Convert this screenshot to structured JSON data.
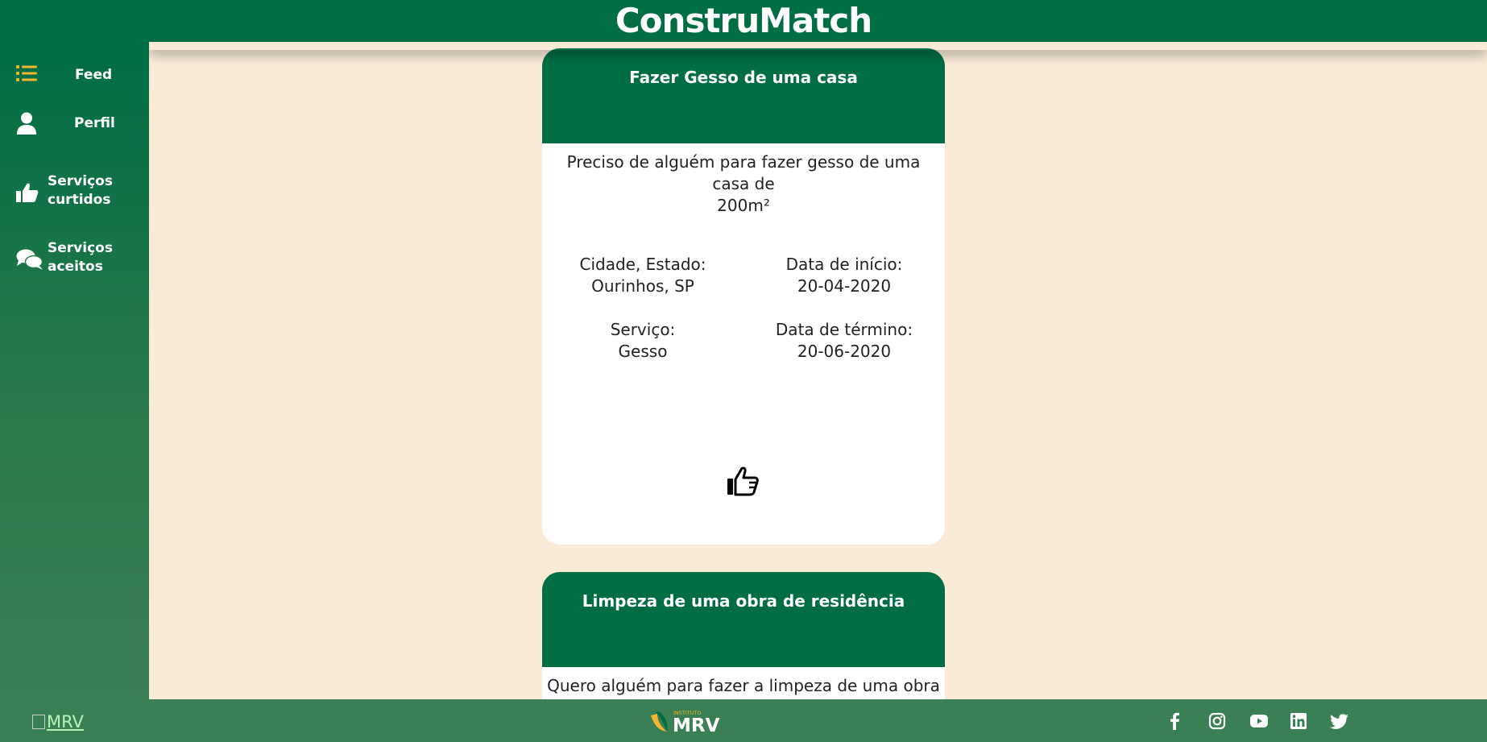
{
  "app": {
    "title": "ConstruMatch"
  },
  "sidebar": {
    "items": [
      {
        "label": "Feed",
        "icon": "list-icon",
        "active": true
      },
      {
        "label": "Perfil",
        "icon": "user-icon"
      },
      {
        "label_line1": "Serviços",
        "label_line2": "curtidos",
        "icon": "thumbs-up-icon"
      },
      {
        "label_line1": "Serviços",
        "label_line2": "aceitos",
        "icon": "chat-bubbles-icon"
      }
    ]
  },
  "cards": [
    {
      "title": "Fazer Gesso de uma casa",
      "description_line1": "Preciso de alguém para fazer gesso de uma casa de",
      "description_line2": "200m²",
      "city_label": "Cidade, Estado:",
      "city_value": "Ourinhos, SP",
      "start_label": "Data de início:",
      "start_value": "20-04-2020",
      "service_label": "Serviço:",
      "service_value": "Gesso",
      "end_label": "Data de término:",
      "end_value": "20-06-2020"
    },
    {
      "title": "Limpeza de uma obra de residência",
      "description_line1": "Quero alguém para fazer a limpeza de uma obra de"
    }
  ],
  "footer": {
    "broken_image_alt": "MRV",
    "logo_small_text": "INSTITUTO",
    "logo_text": "MRV",
    "social": [
      "facebook-icon",
      "instagram-icon",
      "youtube-icon",
      "linkedin-icon",
      "twitter-icon"
    ]
  },
  "colors": {
    "primary_green": "#006d43",
    "accent_yellow": "#f2b632",
    "background": "#faebd7",
    "footer_green": "#3b7f55"
  }
}
